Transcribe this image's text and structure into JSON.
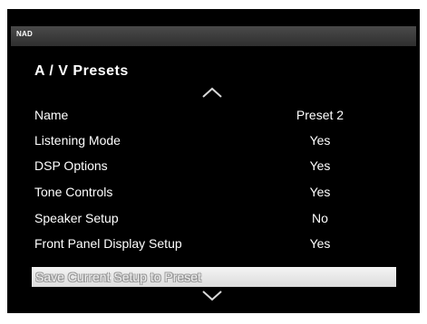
{
  "header": {
    "brand": "NAD"
  },
  "page": {
    "title": "A / V  Presets"
  },
  "menu": [
    {
      "label": "Name",
      "value": "Preset 2"
    },
    {
      "label": "Listening Mode",
      "value": "Yes"
    },
    {
      "label": "DSP Options",
      "value": "Yes"
    },
    {
      "label": "Tone Controls",
      "value": "Yes"
    },
    {
      "label": "Speaker Setup",
      "value": "No"
    },
    {
      "label": "Front Panel Display Setup",
      "value": "Yes"
    }
  ],
  "selected_item": {
    "label": "Save Current Setup to Preset"
  },
  "icons": {
    "scroll_up": "chevron-up-icon",
    "scroll_down": "chevron-down-icon"
  }
}
